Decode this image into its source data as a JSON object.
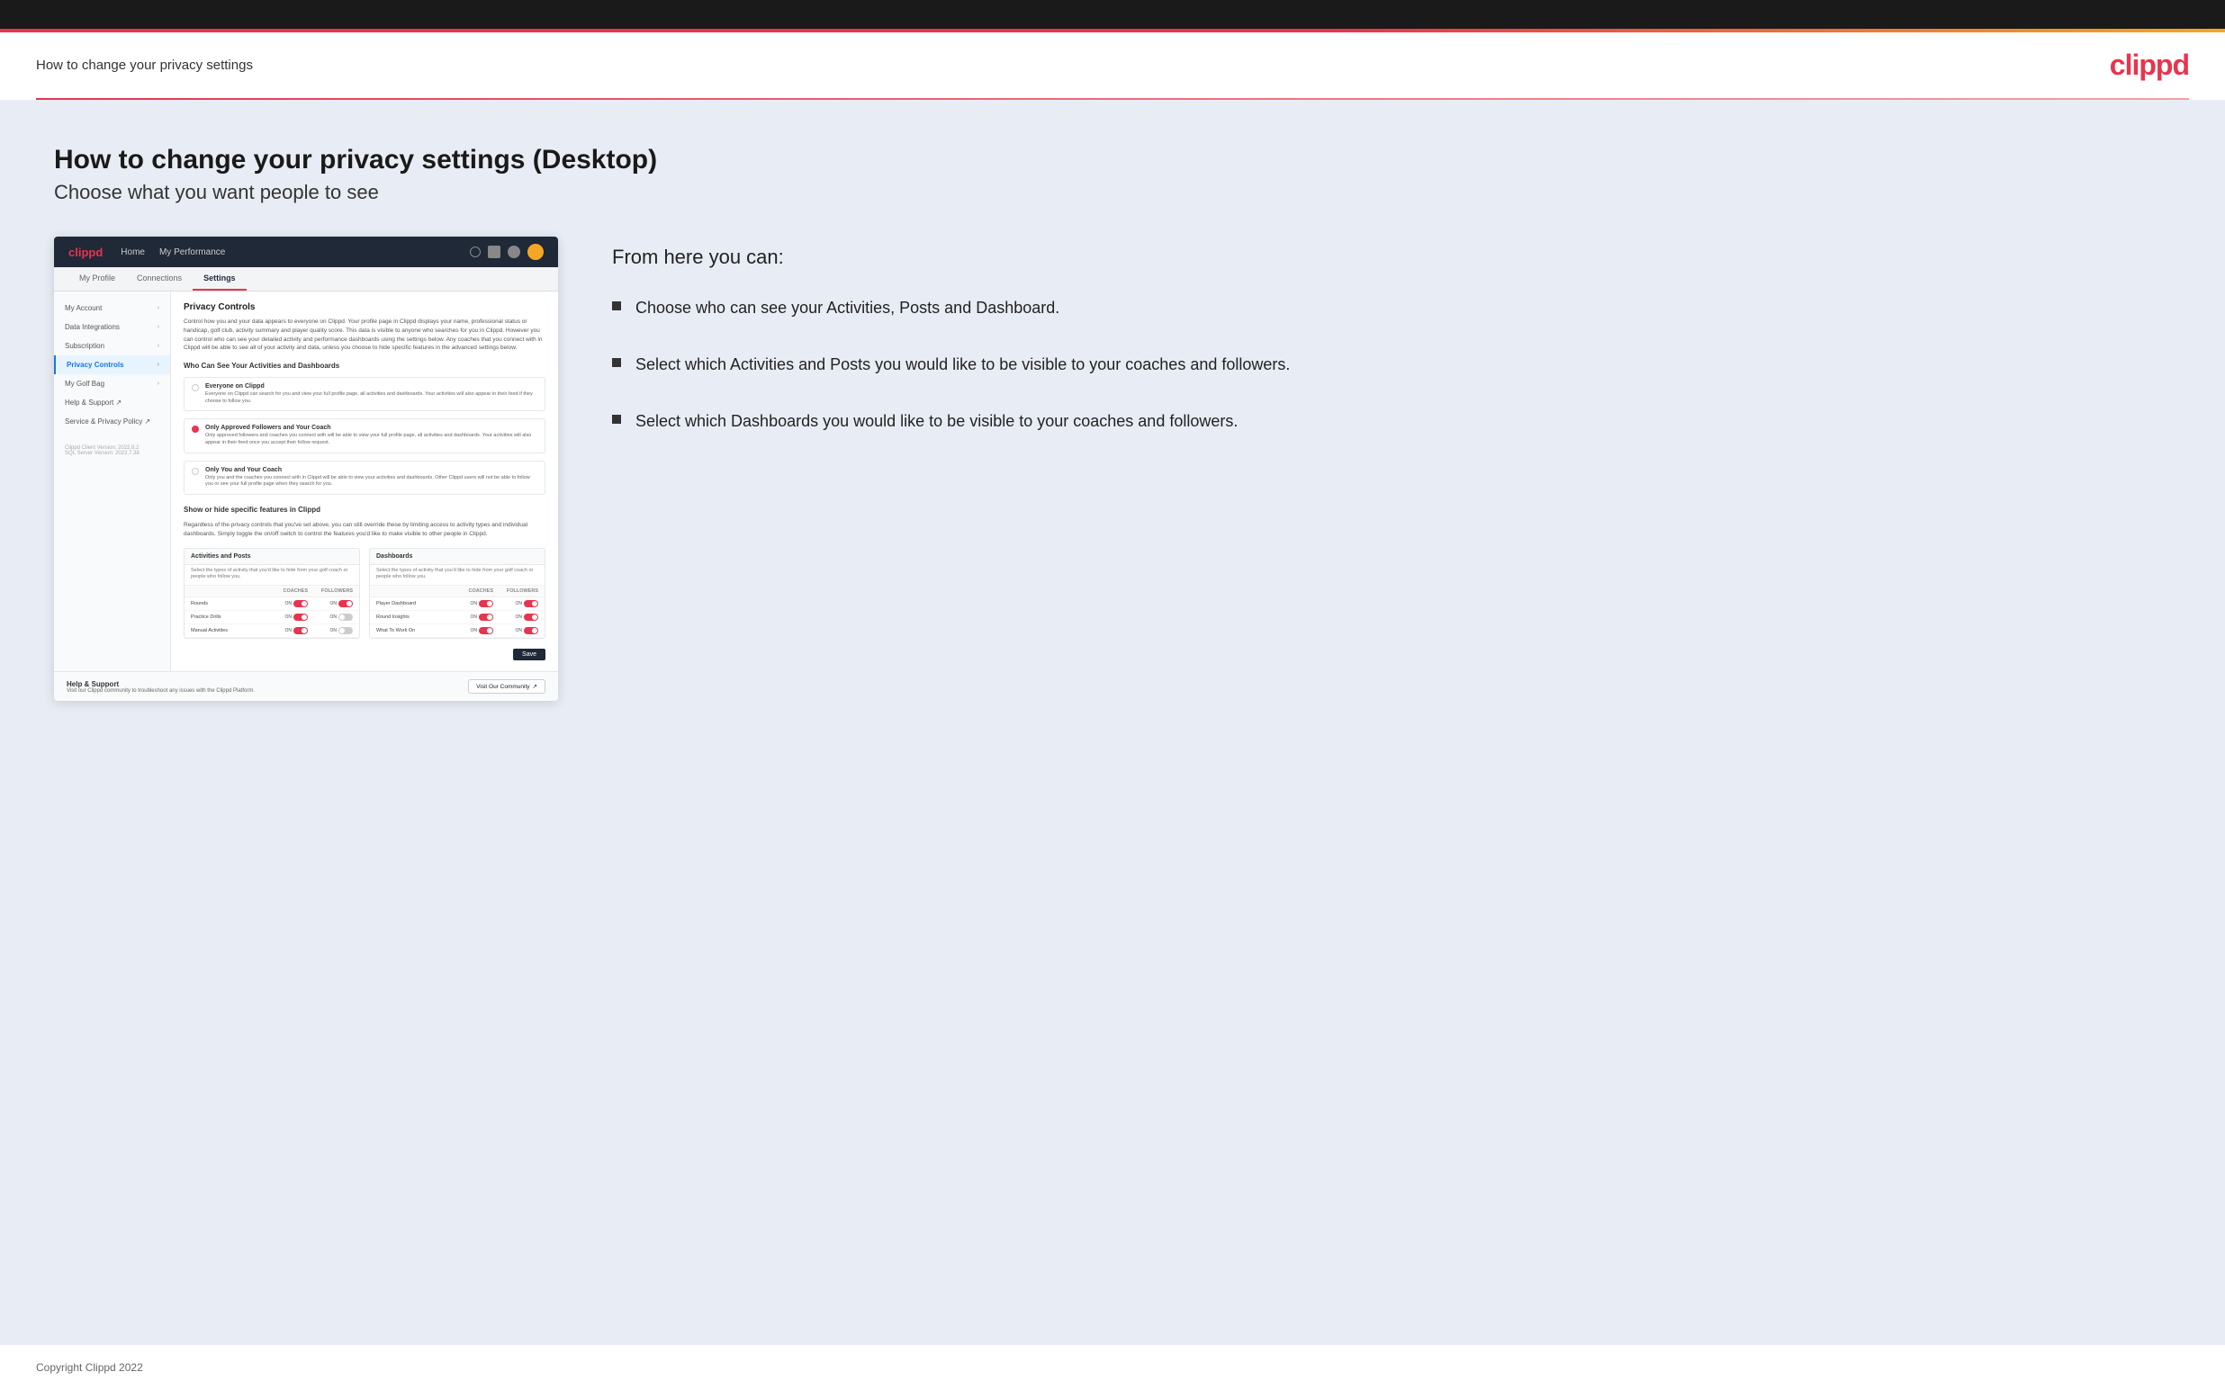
{
  "header": {
    "title": "How to change your privacy settings",
    "logo": "clippd"
  },
  "page": {
    "main_heading": "How to change your privacy settings (Desktop)",
    "sub_heading": "Choose what you want people to see"
  },
  "screenshot": {
    "navbar": {
      "logo": "clippd",
      "links": [
        "Home",
        "My Performance"
      ],
      "icons": [
        "search",
        "grid",
        "settings",
        "avatar"
      ]
    },
    "tabs": [
      {
        "label": "My Profile",
        "active": false
      },
      {
        "label": "Connections",
        "active": false
      },
      {
        "label": "Settings",
        "active": true
      }
    ],
    "sidebar": {
      "items": [
        {
          "label": "My Account",
          "active": false
        },
        {
          "label": "Data Integrations",
          "active": false
        },
        {
          "label": "Subscription",
          "active": false
        },
        {
          "label": "Privacy Controls",
          "active": true
        },
        {
          "label": "My Golf Bag",
          "active": false
        },
        {
          "label": "Help & Support",
          "active": false,
          "external": true
        },
        {
          "label": "Service & Privacy Policy",
          "active": false,
          "external": true
        }
      ],
      "footer_lines": [
        "Clippd Client Version: 2022.8.2",
        "SQL Server Version: 2022.7.38"
      ]
    },
    "panel": {
      "title": "Privacy Controls",
      "description": "Control how you and your data appears to everyone on Clippd. Your profile page in Clippd displays your name, professional status or handicap, golf club, activity summary and player quality score. This data is visible to anyone who searches for you in Clippd. However you can control who can see your detailed activity and performance dashboards using the settings below. Any coaches that you connect with in Clippd will be able to see all of your activity and data, unless you choose to hide specific features in the advanced settings below.",
      "who_can_see_heading": "Who Can See Your Activities and Dashboards",
      "radio_options": [
        {
          "label": "Everyone on Clippd",
          "description": "Everyone on Clippd can search for you and view your full profile page, all activities and dashboards. Your activities will also appear in their feed if they choose to follow you.",
          "selected": false
        },
        {
          "label": "Only Approved Followers and Your Coach",
          "description": "Only approved followers and coaches you connect with will be able to view your full profile page, all activities and dashboards. Your activities will also appear in their feed once you accept their follow request.",
          "selected": true
        },
        {
          "label": "Only You and Your Coach",
          "description": "Only you and the coaches you connect with in Clippd will be able to view your activities and dashboards. Other Clippd users will not be able to follow you or see your full profile page when they search for you.",
          "selected": false
        }
      ],
      "show_hide_heading": "Show or hide specific features in Clippd",
      "show_hide_desc": "Regardless of the privacy controls that you've set above, you can still override these by limiting access to activity types and individual dashboards. Simply toggle the on/off switch to control the features you'd like to make visible to other people in Clippd.",
      "activities_table": {
        "title": "Activities and Posts",
        "description": "Select the types of activity that you'd like to hide from your golf coach or people who follow you.",
        "columns": [
          "",
          "COACHES",
          "FOLLOWERS"
        ],
        "rows": [
          {
            "label": "Rounds",
            "coaches_on": true,
            "followers_on": true
          },
          {
            "label": "Practice Drills",
            "coaches_on": true,
            "followers_on": false
          },
          {
            "label": "Manual Activities",
            "coaches_on": true,
            "followers_on": false
          }
        ]
      },
      "dashboards_table": {
        "title": "Dashboards",
        "description": "Select the types of activity that you'd like to hide from your golf coach or people who follow you.",
        "columns": [
          "",
          "COACHES",
          "FOLLOWERS"
        ],
        "rows": [
          {
            "label": "Player Dashboard",
            "coaches_on": true,
            "followers_on": true
          },
          {
            "label": "Round Insights",
            "coaches_on": true,
            "followers_on": true
          },
          {
            "label": "What To Work On",
            "coaches_on": true,
            "followers_on": true
          }
        ]
      },
      "save_button": "Save"
    },
    "help_section": {
      "title": "Help & Support",
      "description": "Visit our Clippd community to troubleshoot any issues with the Clippd Platform.",
      "button": "Visit Our Community"
    }
  },
  "bullets": {
    "heading": "From here you can:",
    "items": [
      "Choose who can see your Activities, Posts and Dashboard.",
      "Select which Activities and Posts you would like to be visible to your coaches and followers.",
      "Select which Dashboards you would like to be visible to your coaches and followers."
    ]
  },
  "footer": {
    "text": "Copyright Clippd 2022"
  }
}
